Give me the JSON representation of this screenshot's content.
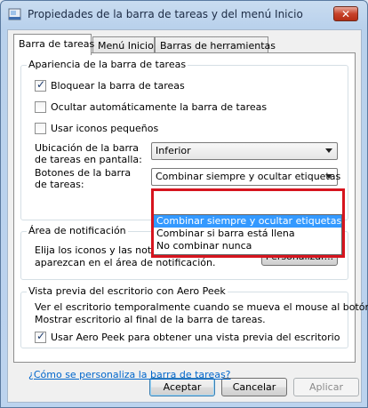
{
  "window": {
    "title": "Propiedades de la barra de tareas y del menú Inicio",
    "close_label": "✕"
  },
  "tabs": [
    {
      "label": "Barra de tareas",
      "active": true
    },
    {
      "label": "Menú Inicio",
      "active": false
    },
    {
      "label": "Barras de herramientas",
      "active": false
    }
  ],
  "appearance": {
    "title": "Apariencia de la barra de tareas",
    "lock": {
      "label": "Bloquear la barra de tareas",
      "checked": true
    },
    "autohide": {
      "label": "Ocultar automáticamente la barra de tareas",
      "checked": false
    },
    "small_icons": {
      "label": "Usar iconos pequeños",
      "checked": false
    },
    "location_label": "Ubicación de la barra de tareas en pantalla:",
    "location_value": "Inferior",
    "buttons_label": "Botones de la barra de tareas:",
    "buttons_value": "Combinar siempre y ocultar etiquetas",
    "buttons_options": [
      "Combinar siempre y ocultar etiquetas",
      "Combinar si barra está llena",
      "No combinar nunca"
    ]
  },
  "notification": {
    "title": "Área de notificación",
    "desc_line1": "Elija los iconos y las notificaciones que desea que",
    "desc_line2": "aparezcan en el área de notificación.",
    "customize_label": "Personalizar..."
  },
  "aero_peek": {
    "title": "Vista previa del escritorio con Aero Peek",
    "desc_line1": "Ver el escritorio temporalmente cuando se mueva el mouse al botón",
    "desc_line2": "Mostrar escritorio al final de la barra de tareas.",
    "use_peek": {
      "label": "Usar Aero Peek para obtener una vista previa del escritorio",
      "checked": true
    }
  },
  "help_link": "¿Cómo se personaliza la barra de tareas?",
  "buttons": {
    "accept": "Aceptar",
    "cancel": "Cancelar",
    "apply": "Aplicar"
  },
  "colors": {
    "highlight_border": "#d6141e",
    "selection": "#3399ff"
  }
}
